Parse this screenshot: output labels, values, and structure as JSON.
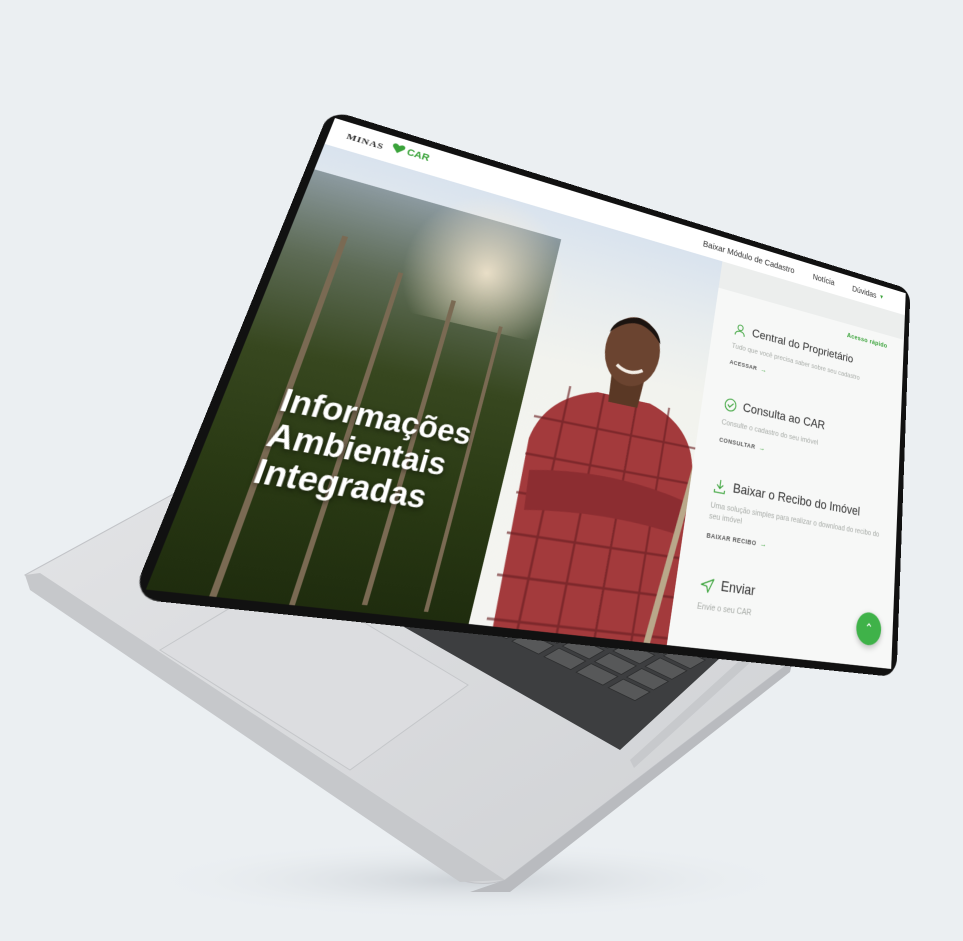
{
  "header": {
    "logo_state": "MINAS",
    "logo_car": "CAR",
    "nav": [
      {
        "label": "Baixar Módulo de Cadastro"
      },
      {
        "label": "Notícia"
      },
      {
        "label": "Dúvidas",
        "has_dropdown": true
      }
    ]
  },
  "hero": {
    "title_lines": [
      "Informações",
      "Ambientais",
      "Integradas"
    ]
  },
  "panel": {
    "quick_access_label": "Acesso rápido",
    "items": [
      {
        "icon": "user-icon",
        "title": "Central do Proprietário",
        "desc": "Tudo que você precisa saber sobre seu cadastro",
        "cta": "ACESSAR"
      },
      {
        "icon": "check-circle-icon",
        "title": "Consulta ao CAR",
        "desc": "Consulte o cadastro do seu imóvel",
        "cta": "CONSULTAR"
      },
      {
        "icon": "download-icon",
        "title": "Baixar o Recibo do Imóvel",
        "desc": "Uma solução simples para realizar o download do recibo do seu imóvel",
        "cta": "BAIXAR RECIBO"
      },
      {
        "icon": "send-icon",
        "title": "Enviar",
        "desc": "Envie o seu CAR",
        "cta": ""
      }
    ]
  },
  "fab": {
    "icon": "chevron-up-icon"
  },
  "colors": {
    "accent": "#3aa33a",
    "background": "#ebeff2",
    "laptop": "#d6d8db",
    "keys": "#575859"
  }
}
